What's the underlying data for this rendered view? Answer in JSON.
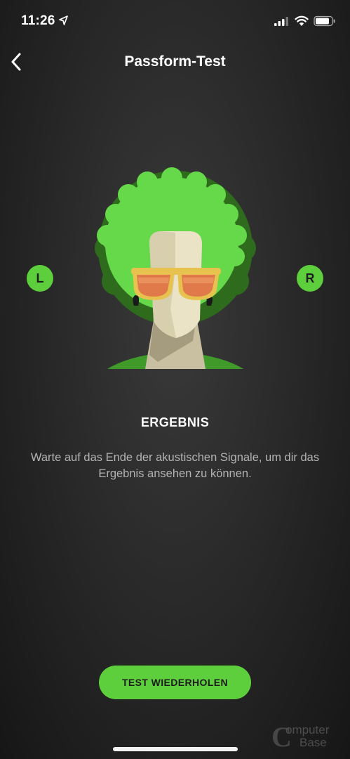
{
  "status_bar": {
    "time": "11:26",
    "icons": [
      "location-arrow-icon",
      "cellular-signal-icon",
      "wifi-icon",
      "battery-icon"
    ]
  },
  "nav": {
    "back_icon": "chevron-left-icon",
    "title": "Passform-Test"
  },
  "illustration": {
    "left_label": "L",
    "right_label": "R",
    "accent_color": "#5ecf3c"
  },
  "result": {
    "title": "ERGEBNIS",
    "description": "Warte auf das Ende der akustischen Signale, um dir das Ergebnis ansehen zu können."
  },
  "actions": {
    "retry_label": "TEST WIEDERHOLEN"
  },
  "watermark": {
    "line1": "omputer",
    "line2": "Base"
  }
}
